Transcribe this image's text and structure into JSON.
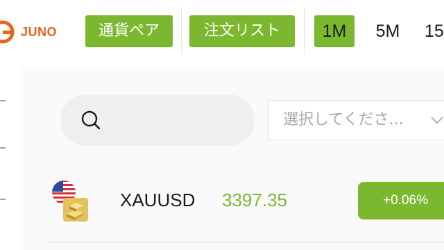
{
  "brand": {
    "name": "JUNO",
    "accent": "#e8641c"
  },
  "header": {
    "buttons": [
      {
        "label": "通貨ペア"
      },
      {
        "label": "注文リスト"
      }
    ],
    "timeframes": [
      {
        "label": "1M",
        "active": true
      },
      {
        "label": "5M",
        "active": false
      },
      {
        "label": "15",
        "active": false
      }
    ]
  },
  "filters": {
    "search": {
      "placeholder": "",
      "icon": "search-icon"
    },
    "select": {
      "placeholder": "選択してくださ...",
      "icon": "chevron-down-icon"
    }
  },
  "instruments": [
    {
      "symbol": "XAUUSD",
      "price": "3397.35",
      "change": "+0.06%",
      "icons": [
        "us-flag-icon",
        "gold-bars-icon"
      ]
    }
  ],
  "colors": {
    "green": "#7cb82f",
    "orange": "#e8641c",
    "placeholder_gray": "#a7a7a7"
  }
}
